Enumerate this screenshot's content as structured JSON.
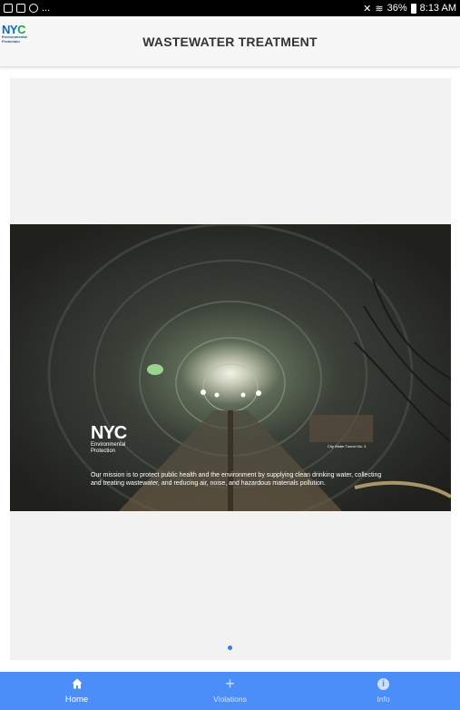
{
  "status_bar": {
    "left_icons": [
      "gallery-icon",
      "mail-icon",
      "sync-icon"
    ],
    "more": "...",
    "right_icons": [
      "mute-icon",
      "wifi-icon"
    ],
    "battery": "36%",
    "time": "8:13 AM"
  },
  "header": {
    "logo_text": "NYC",
    "logo_subtitle": "Environmental Protection",
    "title": "WASTEWATER TREATMENT"
  },
  "carousel": {
    "slide": {
      "logo_text": "NYC",
      "logo_subtitle_line1": "Environmental",
      "logo_subtitle_line2": "Protection",
      "photo_credit": "City Water Tunnel No. 3",
      "caption": "Our mission is to protect public health and the environment by supplying clean drinking water, collecting and treating wastewater, and reducing air, noise, and hazardous materials pollution."
    },
    "page_count": 1,
    "active_index": 0,
    "indicator_color": "#2f80ed"
  },
  "tabs": [
    {
      "label": "Home",
      "icon": "home-icon",
      "active": true
    },
    {
      "label": "Violations",
      "icon": "plus-icon",
      "active": false
    },
    {
      "label": "Info",
      "icon": "info-icon",
      "active": false
    }
  ],
  "colors": {
    "tab_bar": "#4c8ef7",
    "header_bg": "#f7f7f7",
    "carousel_bg": "#f2f2f2"
  }
}
